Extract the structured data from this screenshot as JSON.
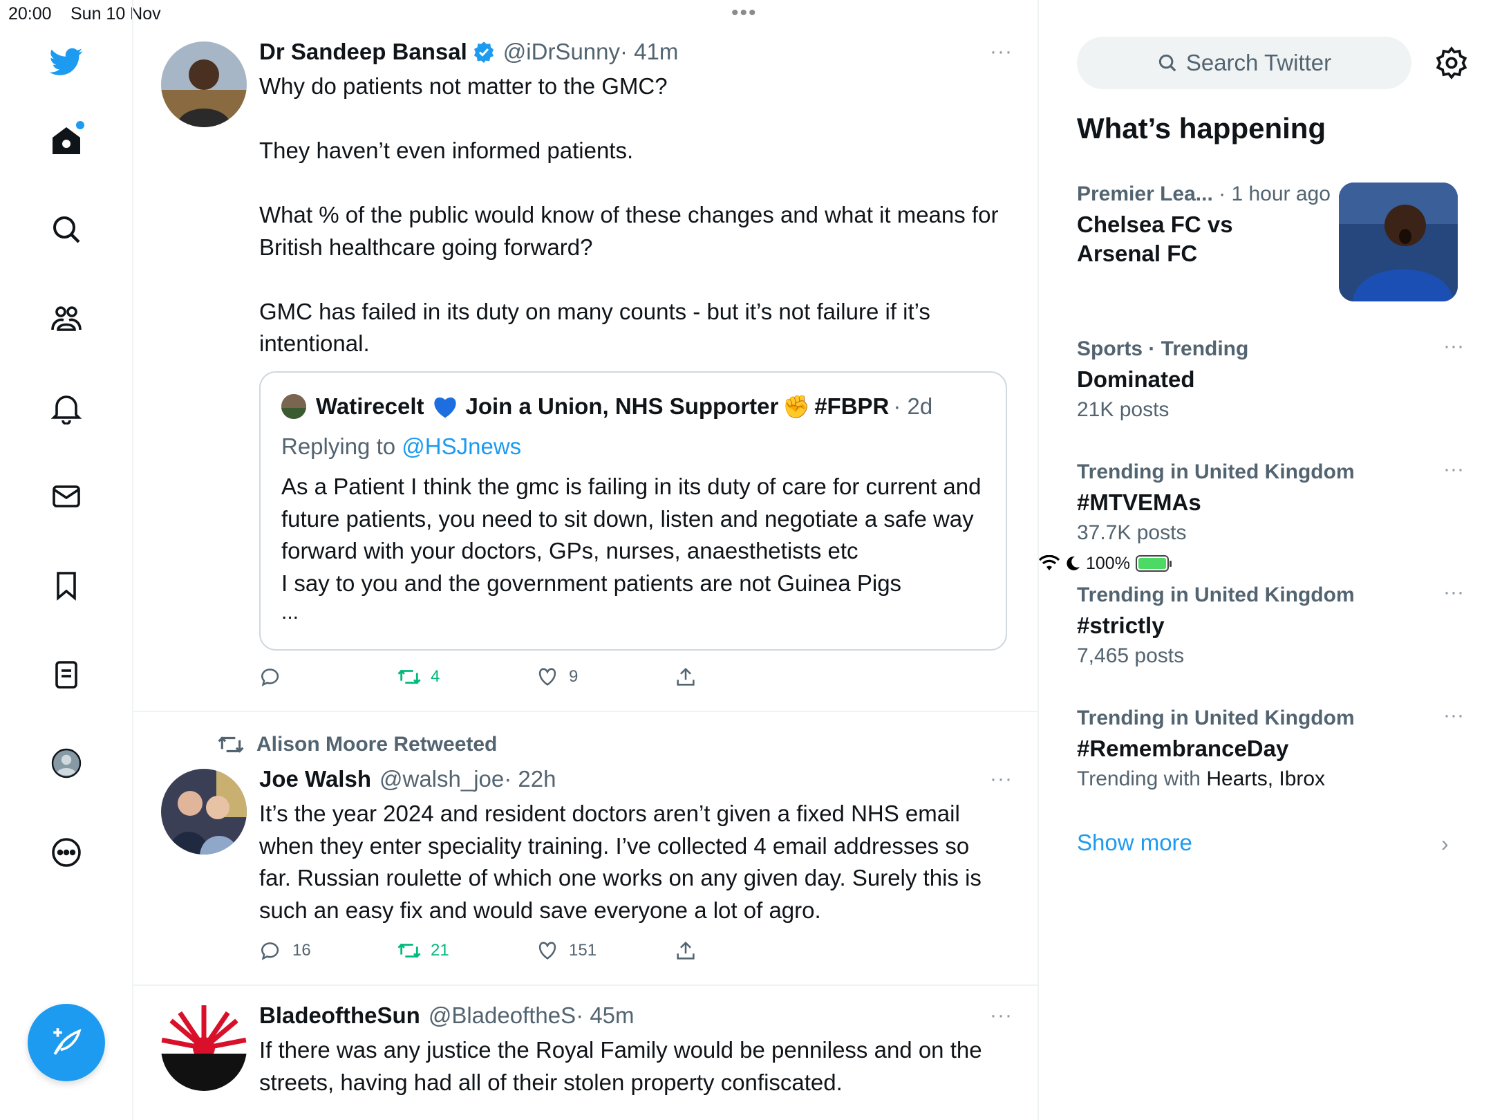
{
  "status_bar": {
    "time": "20:00",
    "date": "Sun 10 Nov",
    "battery": "100%",
    "multitask_dots": "•••"
  },
  "nav": {
    "icons": [
      "twitter-logo-icon",
      "home-icon",
      "search-icon",
      "communities-icon",
      "notifications-icon",
      "messages-icon",
      "bookmarks-icon",
      "lists-icon",
      "profile-icon",
      "more-icon"
    ],
    "accent": "#1d9bf0"
  },
  "tweets": [
    {
      "name": "Dr Sandeep Bansal",
      "handle": "@iDrSunny",
      "time": "· 41m",
      "text": "Why do patients not matter to the GMC?\n\nThey haven’t even informed patients.\n\nWhat % of the public would know of these changes and what it means for British healthcare going forward?\n\nGMC has failed in its duty on many counts - but it’s not failure if it’s intentional.",
      "quote": {
        "name": "Watirecelt",
        "name_rest": "Join a Union, NHS Supporter",
        "tag": "#FBPR",
        "time": "· 2d",
        "replying_label": "Replying to",
        "replying_to": "@HSJnews",
        "text": "As a Patient I think the gmc is failing in its duty of care for current and future patients, you need to sit down, listen and negotiate a safe way forward with your doctors, GPs, nurses, anaesthetists etc\nI say to you and the government patients are not Guinea Pigs",
        "ellipsis": "..."
      },
      "replies": "",
      "retweets": "4",
      "likes": "9"
    },
    {
      "retweeted_by": "Alison Moore Retweeted",
      "name": "Joe Walsh",
      "handle": "@walsh_joe",
      "time": "· 22h",
      "text": "It’s the year 2024 and resident doctors aren’t given a fixed NHS email when they enter speciality training. I’ve collected 4 email addresses so far. Russian roulette of which one works on any given day. Surely this is such an easy fix and would save everyone a lot of agro.",
      "replies": "16",
      "retweets": "21",
      "likes": "151"
    },
    {
      "name": "BladeoftheSun",
      "handle": "@BladeoftheS",
      "time": "· 45m",
      "text": "If there was any justice the Royal Family would be penniless and on the streets, having had all of their stolen property confiscated."
    }
  ],
  "sidebar": {
    "search_placeholder": "Search Twitter",
    "title": "What’s happening",
    "news": {
      "category": "Premier Lea...",
      "time": " · 1 hour ago",
      "headline": "Chelsea FC vs Arsenal FC"
    },
    "trends": [
      {
        "meta": "Sports · Trending",
        "topic": "Dominated",
        "count": "21K posts"
      },
      {
        "meta": "Trending in United Kingdom",
        "topic": "#MTVEMAs",
        "count": "37.7K posts"
      },
      {
        "meta": "Trending in United Kingdom",
        "topic": "#strictly",
        "count": "7,465 posts"
      },
      {
        "meta": "Trending in United Kingdom",
        "topic": "#RemembranceDay",
        "count_prefix": "Trending with",
        "count_names": "Hearts, Ibrox"
      }
    ],
    "show_more": "Show more"
  },
  "more_glyph": "···"
}
